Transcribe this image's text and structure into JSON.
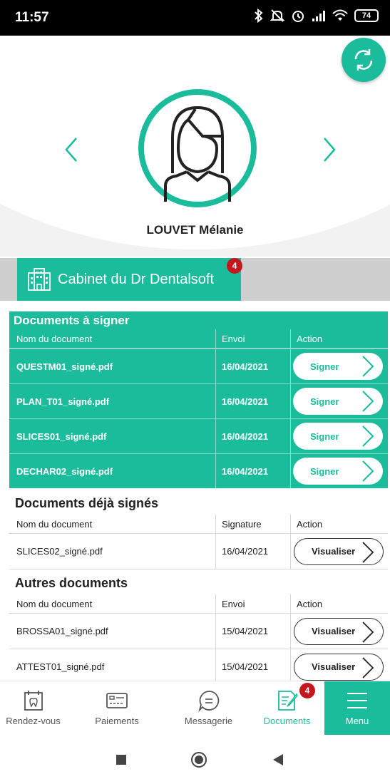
{
  "status_bar": {
    "time": "11:57",
    "battery": "74",
    "icons": [
      "bluetooth-icon",
      "mute-icon",
      "alarm-icon",
      "signal-icon",
      "wifi-icon",
      "battery-icon"
    ]
  },
  "profile": {
    "patient_name": "LOUVET Mélanie"
  },
  "office": {
    "label": "Cabinet du Dr Dentalsoft",
    "badge": "4"
  },
  "to_sign": {
    "title": "Documents à signer",
    "headers": [
      "Nom du document",
      "Envoi",
      "Action"
    ],
    "action_label": "Signer",
    "rows": [
      {
        "name": "QUESTM01_signé.pdf",
        "date": "16/04/2021"
      },
      {
        "name": "PLAN_T01_signé.pdf",
        "date": "16/04/2021"
      },
      {
        "name": "SLICES01_signé.pdf",
        "date": "16/04/2021"
      },
      {
        "name": "DECHAR02_signé.pdf",
        "date": "16/04/2021"
      }
    ]
  },
  "signed": {
    "title": "Documents déjà signés",
    "headers": [
      "Nom du document",
      "Signature",
      "Action"
    ],
    "action_label": "Visualiser",
    "rows": [
      {
        "name": "SLICES02_signé.pdf",
        "date": "16/04/2021"
      }
    ]
  },
  "others": {
    "title": "Autres documents",
    "headers": [
      "Nom du document",
      "Envoi",
      "Action"
    ],
    "action_label": "Visualiser",
    "rows": [
      {
        "name": "BROSSA01_signé.pdf",
        "date": "15/04/2021"
      },
      {
        "name": "ATTEST01_signé.pdf",
        "date": "15/04/2021"
      }
    ]
  },
  "bottom_nav": {
    "items": [
      {
        "label": "Rendez-vous"
      },
      {
        "label": "Paiements"
      },
      {
        "label": "Messagerie"
      },
      {
        "label": "Documents",
        "badge": "4"
      },
      {
        "label": "Menu"
      }
    ]
  },
  "colors": {
    "accent": "#1bbc9b",
    "badge": "#c4161c"
  }
}
